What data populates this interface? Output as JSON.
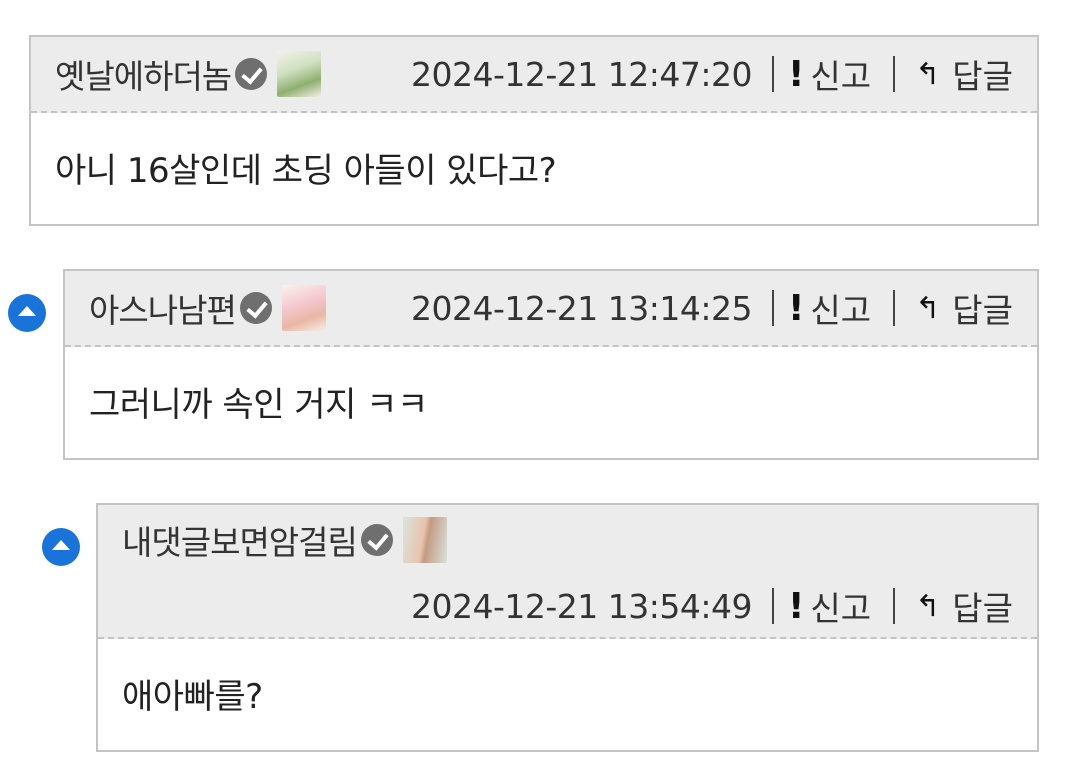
{
  "actions": {
    "report_label": "신고",
    "reply_label": "답글",
    "report_icon": "exclamation-icon",
    "reply_icon": "reply-arrow-icon"
  },
  "colors": {
    "collapse_button": "#1a73d8",
    "header_background": "#ececec",
    "border": "#c4c4c4"
  },
  "comments": [
    {
      "author": "옛날에하더놈",
      "timestamp": "2024-12-21 12:47:20",
      "text": "아니 16살인데 초딩 아들이 있다고?",
      "verified": true
    },
    {
      "author": "아스나남편",
      "timestamp": "2024-12-21 13:14:25",
      "text": "그러니까 속인 거지 ㅋㅋ",
      "verified": true
    },
    {
      "author": "내댓글보면암걸림",
      "timestamp": "2024-12-21 13:54:49",
      "text": "애아빠를?",
      "verified": true
    }
  ]
}
